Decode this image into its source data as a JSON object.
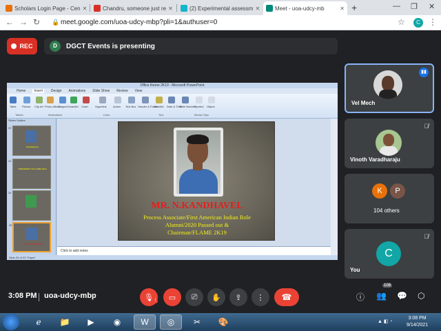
{
  "browser": {
    "tabs": [
      {
        "title": "Scholars Login Page - Cen",
        "color": "#e8710a",
        "active": false
      },
      {
        "title": "Chandru, someone just re",
        "color": "#d93025",
        "active": false
      },
      {
        "title": "(2) Experimental assessm",
        "color": "#12b5cb",
        "active": false
      },
      {
        "title": "Meet - uoa-udcy-mb",
        "color": "#00897b",
        "active": true
      }
    ],
    "new_tab": "+",
    "url": "meet.google.com/uoa-udcy-mbp?pli=1&authuser=0",
    "profile_letter": "C"
  },
  "meet": {
    "rec_label": "REC",
    "presenter_initial": "D",
    "presenting_text": "DGCT Events is presenting",
    "time": "3:08 PM",
    "meeting_code": "uoa-udcy-mbp",
    "participant_count": "108",
    "participants": [
      {
        "name": "Vel Mech",
        "speaking": true
      },
      {
        "name": "Vinoth Varadharaju",
        "speaking": false
      },
      {
        "name": "104 others",
        "letters": [
          "K",
          "P"
        ],
        "letter_colors": [
          "#e8710a",
          "#795548"
        ]
      },
      {
        "name": "You",
        "letter": "C",
        "letter_color": "#12a6a6"
      }
    ]
  },
  "powerpoint": {
    "window_title": "Office theme 2K19 - Microsoft PowerPoint",
    "tabs": [
      "Home",
      "Insert",
      "Design",
      "Animations",
      "Slide Show",
      "Review",
      "View"
    ],
    "active_tab": "Insert",
    "ribbon_items": [
      "Table",
      "Picture",
      "Clip Art",
      "Photo Album",
      "Shapes",
      "SmartArt",
      "Chart",
      "Hyperlink",
      "Action",
      "Text Box",
      "Header & Footer",
      "WordArt",
      "Date & Time",
      "Slide Number",
      "Symbol",
      "Object",
      "Movie",
      "Sound"
    ],
    "ribbon_groups": [
      "Tables",
      "Illustrations",
      "Links",
      "Text",
      "Media Clips"
    ],
    "panel_tabs": "Slides   Outline",
    "notes_placeholder": "Click to add notes",
    "status": "Slide 25 of 33   \"Paper\"",
    "slide": {
      "name": "MR. N.KANDHAVEL",
      "subtitle_lines": [
        "Process Associate/First American Indian Role",
        "Alumni/2020 Passed out &",
        "Chairman/FLAME 2K19"
      ]
    },
    "thumbnails": [
      {
        "num": "22",
        "text": "Kandaswamy",
        "selected": false
      },
      {
        "num": "23",
        "text": "PRESIDENT OF FLAME 2K19",
        "selected": false
      },
      {
        "num": "24",
        "text": "",
        "selected": false
      },
      {
        "num": "25",
        "text": "MR. N.KANDHAVEL",
        "selected": true
      }
    ]
  },
  "taskbar": {
    "clock_time": "3:08 PM",
    "clock_date": "9/14/2021"
  }
}
